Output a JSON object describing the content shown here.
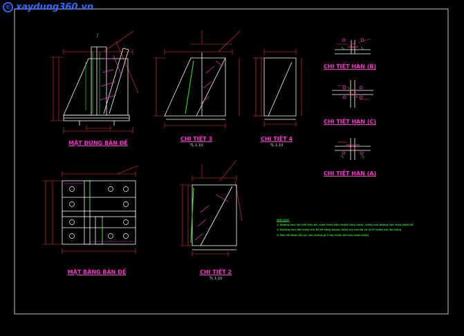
{
  "watermark": {
    "text": "xaydung360.vn"
  },
  "titles": {
    "elevation": "MẶT ĐỨNG BẢN ĐẾ",
    "detail3": "CHI TIẾT 3",
    "detail3_scale": "TL 1:10",
    "detail4": "CHI TIẾT 4",
    "detail4_scale": "TL 1:10",
    "plan": "MẶT BẰNG BẢN ĐẾ",
    "detail2": "CHI TIẾT 2",
    "detail2_scale": "TL 1:10",
    "weldB": "CHI TIẾT HÀN (B)",
    "weldC": "CHI TIẾT HÀN (C)",
    "weldA": "CHI TIẾT HÀN (A)"
  },
  "notes": {
    "heading": "GHI CHÚ:",
    "line1": "1. Đường hàn liên kết bản đế, sườn theo tiêu chuẩn hiện hành, chiều cao đường hàn theo thiết kế",
    "line2": "2. Bulông neo đặt trước khi đổ bê tông móng, kiểm tra cao độ và vị trí trước khi lắp dựng",
    "line3": "3. Bản đế được tẩy gỉ, sơn chống gỉ 2 lớp trước khi sơn hoàn thiện"
  },
  "colors": {
    "background": "#000000",
    "border": "#c8c8c8",
    "geometry": "#ffffff",
    "dimensions": "#ff3030",
    "rebar": "#19e619",
    "hatch": "#ff2ed0",
    "title": "#ff2ed0",
    "watermark": "#2f6cff"
  }
}
